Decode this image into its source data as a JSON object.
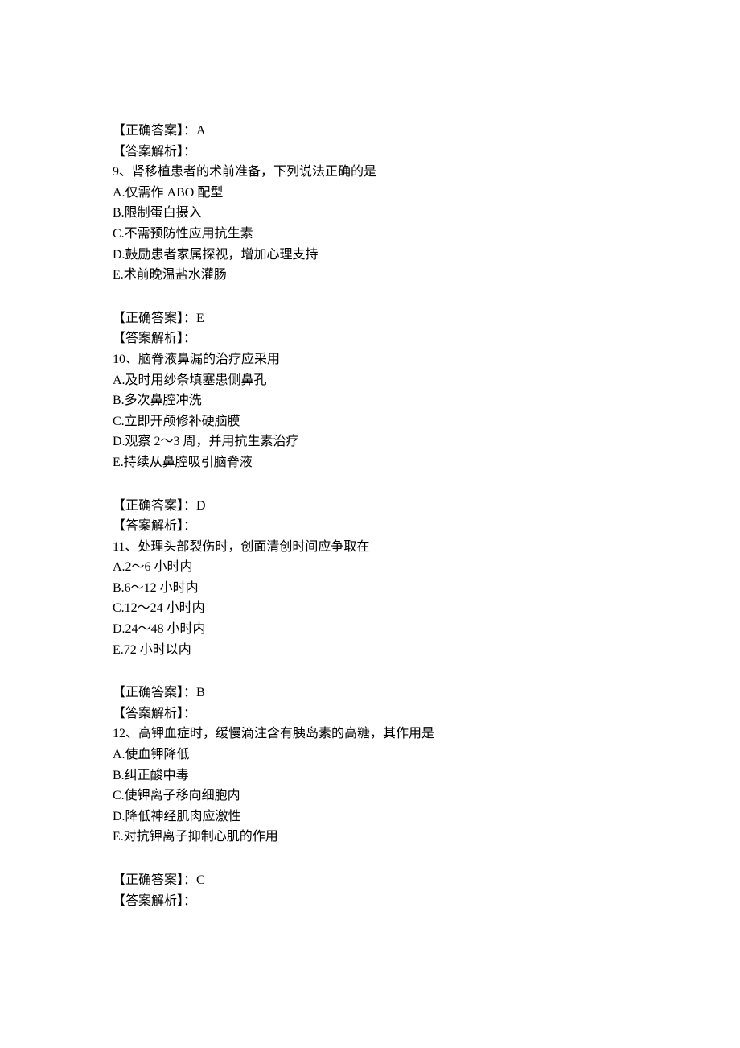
{
  "labels": {
    "correct_answer_prefix": "【正确答案】：",
    "explanation_prefix": "【答案解析】："
  },
  "blocks": [
    {
      "answer": "A",
      "explanation": "",
      "question_number": "9",
      "question_text": "肾移植患者的术前准备，下列说法正确的是",
      "options": [
        "A.仅需作 ABO 配型",
        "B.限制蛋白摄入",
        "C.不需预防性应用抗生素",
        "D.鼓励患者家属探视，增加心理支持",
        "E.术前晚温盐水灌肠"
      ]
    },
    {
      "answer": "E",
      "explanation": "",
      "question_number": "10",
      "question_text": "脑脊液鼻漏的治疗应采用",
      "options": [
        "A.及时用纱条填塞患侧鼻孔",
        "B.多次鼻腔冲洗",
        "C.立即开颅修补硬脑膜",
        "D.观察 2～3 周，并用抗生素治疗",
        "E.持续从鼻腔吸引脑脊液"
      ]
    },
    {
      "answer": "D",
      "explanation": "",
      "question_number": "11",
      "question_text": "处理头部裂伤时，创面清创时间应争取在",
      "options": [
        "A.2～6 小时内",
        "B.6～12 小时内",
        "C.12～24 小时内",
        "D.24～48 小时内",
        "E.72 小时以内"
      ]
    },
    {
      "answer": "B",
      "explanation": "",
      "question_number": "12",
      "question_text": "高钾血症时，缓慢滴注含有胰岛素的高糖，其作用是",
      "options": [
        "A.使血钾降低",
        "B.纠正酸中毒",
        "C.使钾离子移向细胞内",
        "D.降低神经肌肉应激性",
        "E.对抗钾离子抑制心肌的作用"
      ]
    },
    {
      "answer": "C",
      "explanation": ""
    }
  ]
}
